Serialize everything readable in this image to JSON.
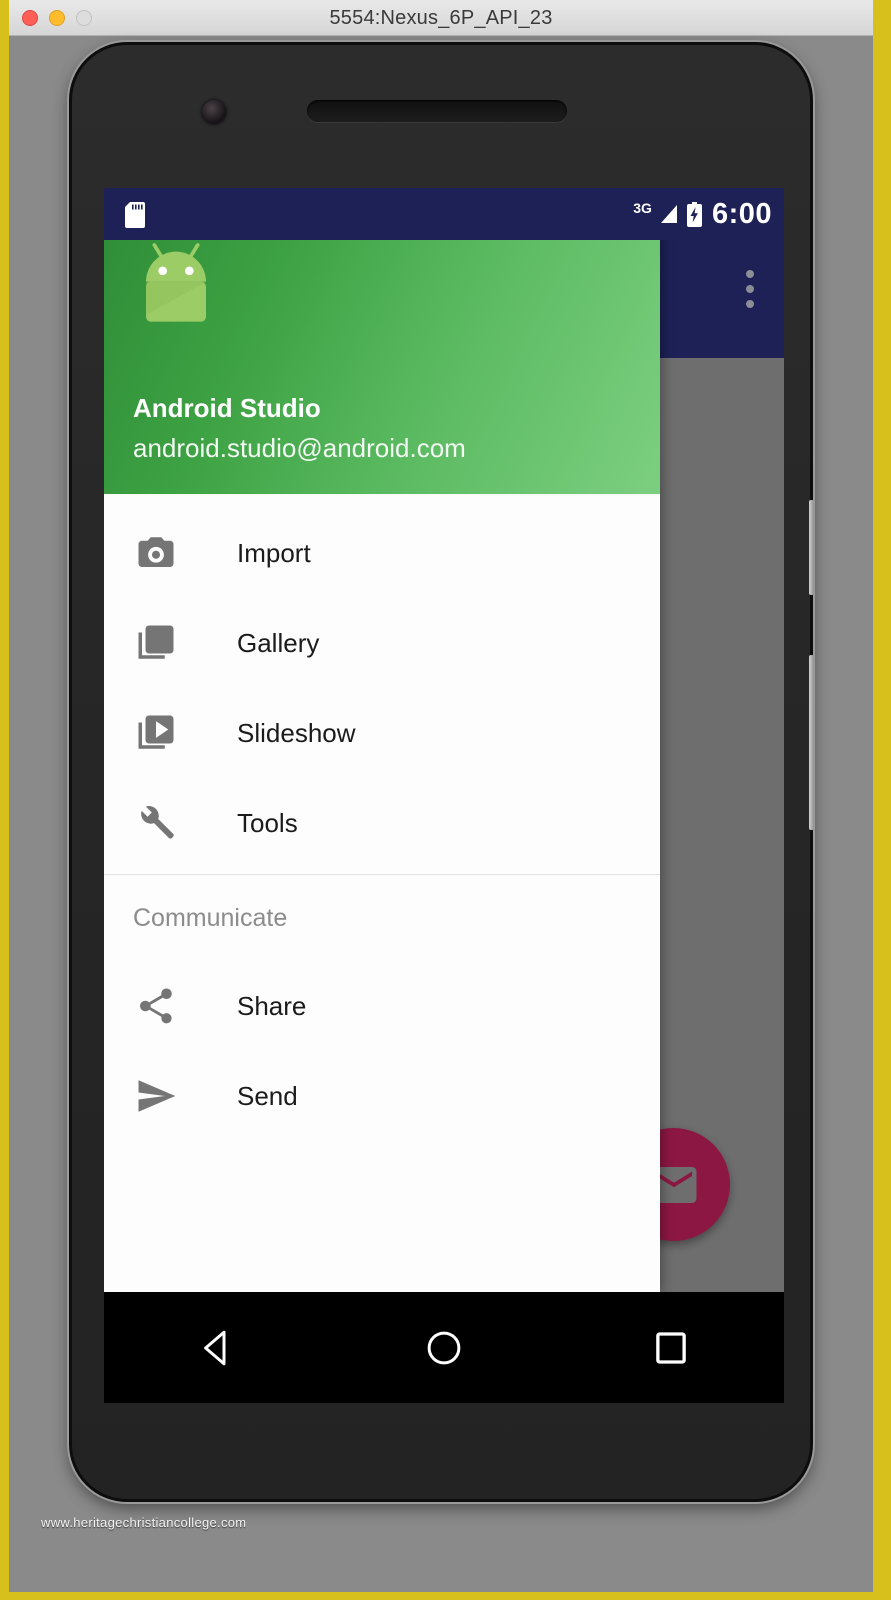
{
  "window": {
    "title": "5554:Nexus_6P_API_23",
    "controls": [
      {
        "name": "close",
        "color": "#ff5f57"
      },
      {
        "name": "minimize",
        "color": "#ffbd2e"
      },
      {
        "name": "maximize",
        "color": "#dddddd"
      }
    ]
  },
  "status_bar": {
    "sd_card_icon": "sd-card-icon",
    "network_label": "3G",
    "signal_icon": "signal-triangle-icon",
    "battery_icon": "battery-charging-icon",
    "time": "6:00",
    "background": "#1d2156"
  },
  "toolbar": {
    "overflow_label": "overflow-menu",
    "background": "#1d2156"
  },
  "drawer": {
    "header": {
      "logo": "android-robot-icon",
      "account_name": "Android Studio",
      "account_email": "android.studio@android.com",
      "gradient_from": "#2e8b37",
      "gradient_to": "#7ccf80"
    },
    "groups": [
      {
        "subheader": null,
        "items": [
          {
            "label": "Import",
            "icon": "camera-icon"
          },
          {
            "label": "Gallery",
            "icon": "photo-library-icon"
          },
          {
            "label": "Slideshow",
            "icon": "video-library-icon"
          },
          {
            "label": "Tools",
            "icon": "wrench-icon"
          }
        ]
      },
      {
        "subheader": "Communicate",
        "items": [
          {
            "label": "Share",
            "icon": "share-icon"
          },
          {
            "label": "Send",
            "icon": "send-icon"
          }
        ]
      }
    ]
  },
  "fab": {
    "icon": "email-icon",
    "color": "#8c1743"
  },
  "navigation_bar": {
    "buttons": [
      {
        "name": "back",
        "icon": "back-triangle-icon"
      },
      {
        "name": "home",
        "icon": "home-circle-icon"
      },
      {
        "name": "recents",
        "icon": "recents-square-icon"
      }
    ]
  },
  "watermark": "www.heritagechristiancollege.com"
}
